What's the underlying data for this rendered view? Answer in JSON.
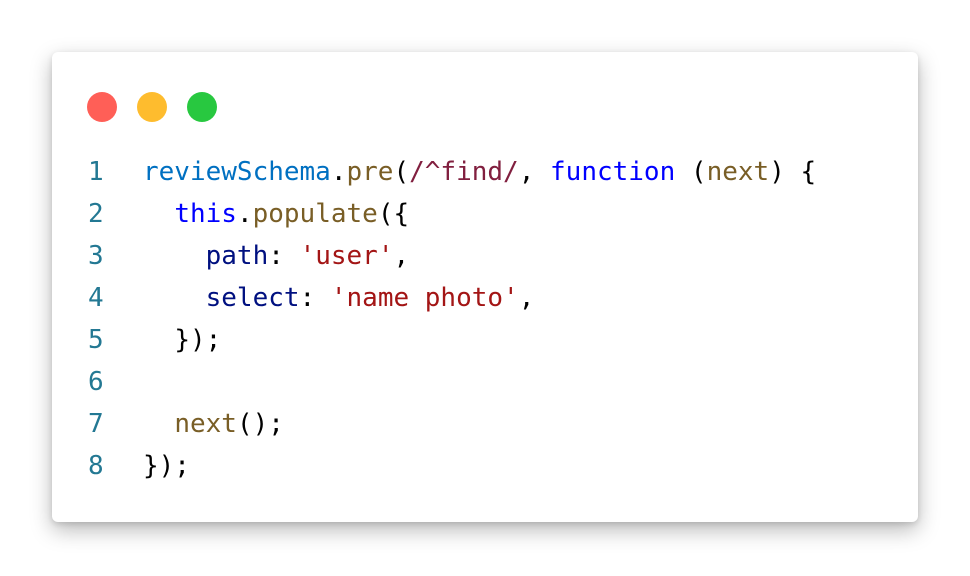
{
  "window": {
    "controls": [
      {
        "name": "close",
        "color": "#ff5f57"
      },
      {
        "name": "minimize",
        "color": "#febc2e"
      },
      {
        "name": "maximize",
        "color": "#28c840"
      }
    ]
  },
  "code": {
    "lines": [
      {
        "number": "1",
        "indent": "",
        "tokens": [
          {
            "text": "reviewSchema",
            "type": "var"
          },
          {
            "text": ".",
            "type": "punc"
          },
          {
            "text": "pre",
            "type": "fn"
          },
          {
            "text": "(",
            "type": "punc"
          },
          {
            "text": "/^find/",
            "type": "regex"
          },
          {
            "text": ", ",
            "type": "punc"
          },
          {
            "text": "function",
            "type": "kw"
          },
          {
            "text": " (",
            "type": "punc"
          },
          {
            "text": "next",
            "type": "fn"
          },
          {
            "text": ") {",
            "type": "punc"
          }
        ]
      },
      {
        "number": "2",
        "indent": "  ",
        "tokens": [
          {
            "text": "this",
            "type": "kw"
          },
          {
            "text": ".",
            "type": "punc"
          },
          {
            "text": "populate",
            "type": "fn"
          },
          {
            "text": "({",
            "type": "punc"
          }
        ]
      },
      {
        "number": "3",
        "indent": "    ",
        "tokens": [
          {
            "text": "path",
            "type": "prop"
          },
          {
            "text": ": ",
            "type": "punc"
          },
          {
            "text": "'user'",
            "type": "str"
          },
          {
            "text": ",",
            "type": "punc"
          }
        ]
      },
      {
        "number": "4",
        "indent": "    ",
        "tokens": [
          {
            "text": "select",
            "type": "prop"
          },
          {
            "text": ": ",
            "type": "punc"
          },
          {
            "text": "'name photo'",
            "type": "str"
          },
          {
            "text": ",",
            "type": "punc"
          }
        ]
      },
      {
        "number": "5",
        "indent": "  ",
        "tokens": [
          {
            "text": "});",
            "type": "punc"
          }
        ]
      },
      {
        "number": "6",
        "indent": "",
        "tokens": []
      },
      {
        "number": "7",
        "indent": "  ",
        "tokens": [
          {
            "text": "next",
            "type": "fn"
          },
          {
            "text": "();",
            "type": "punc"
          }
        ]
      },
      {
        "number": "8",
        "indent": "",
        "tokens": [
          {
            "text": "});",
            "type": "punc"
          }
        ]
      }
    ]
  }
}
